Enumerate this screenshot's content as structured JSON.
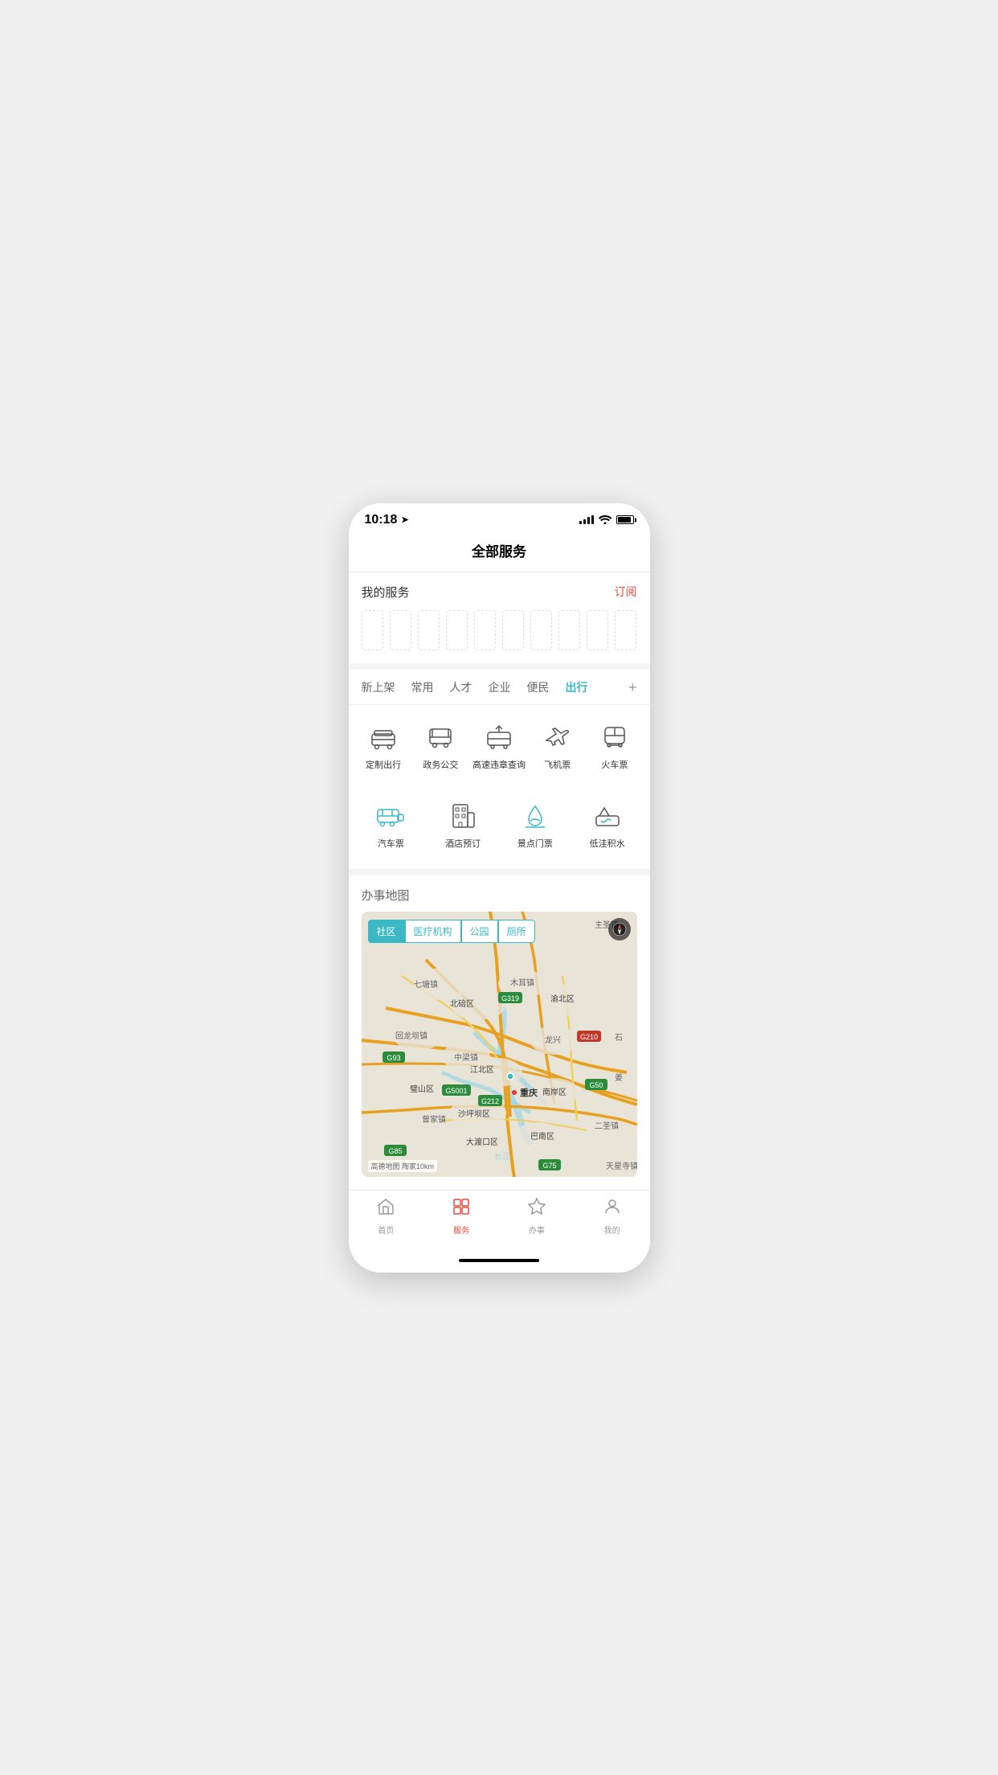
{
  "status": {
    "time": "10:18",
    "location_arrow": "➤"
  },
  "page": {
    "title": "全部服务"
  },
  "my_services": {
    "label": "我的服务",
    "subscribe_btn": "订阅",
    "placeholder_count": 10
  },
  "tabs": [
    {
      "id": "new",
      "label": "新上架",
      "active": false
    },
    {
      "id": "common",
      "label": "常用",
      "active": false
    },
    {
      "id": "talent",
      "label": "人才",
      "active": false
    },
    {
      "id": "enterprise",
      "label": "企业",
      "active": false
    },
    {
      "id": "convenience",
      "label": "便民",
      "active": false
    },
    {
      "id": "travel",
      "label": "出行",
      "active": true
    }
  ],
  "services_row1": [
    {
      "id": "custom-travel",
      "label": "定制出行"
    },
    {
      "id": "gov-bus",
      "label": "政务公交"
    },
    {
      "id": "highway-violation",
      "label": "高速违章查询"
    },
    {
      "id": "flight",
      "label": "飞机票"
    },
    {
      "id": "train",
      "label": "火车票"
    }
  ],
  "services_row2": [
    {
      "id": "bus-ticket",
      "label": "汽车票"
    },
    {
      "id": "hotel",
      "label": "酒店预订"
    },
    {
      "id": "scenic",
      "label": "景点门票"
    },
    {
      "id": "waterlog",
      "label": "低洼积水"
    }
  ],
  "map": {
    "section_title": "办事地图",
    "filter_tabs": [
      "社区",
      "医疗机构",
      "公园",
      "厕所"
    ],
    "attribution": "高德地图 陶家10km",
    "center_city": "重庆",
    "districts": [
      "北碚区",
      "江北区",
      "渝北区",
      "璧山区",
      "沙坪坝区",
      "大渡口区",
      "南岸区",
      "巴南区"
    ],
    "towns": [
      "七塘镇",
      "回龙坝镇",
      "中梁镇",
      "曾家镇",
      "二圣镇",
      "木耳镇",
      "龙兴",
      "天星寺镇",
      "主圣镇"
    ],
    "highway_labels": [
      "G319",
      "G210",
      "G93",
      "G5001",
      "G212",
      "G50",
      "G85",
      "G75"
    ]
  },
  "bottom_nav": [
    {
      "id": "home",
      "label": "首页",
      "active": false
    },
    {
      "id": "service",
      "label": "服务",
      "active": true
    },
    {
      "id": "affairs",
      "label": "办事",
      "active": false
    },
    {
      "id": "mine",
      "label": "我的",
      "active": false
    }
  ],
  "colors": {
    "primary": "#3bb8c3",
    "active_red": "#e74c3c",
    "text_dark": "#333",
    "text_gray": "#666",
    "bg_light": "#f5f5f5"
  }
}
